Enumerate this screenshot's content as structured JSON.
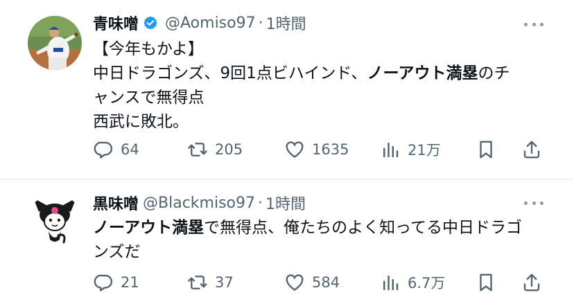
{
  "tweets": [
    {
      "display_name": "青味噌",
      "handle": "@Aomiso97",
      "separator": "·",
      "time": "1時間",
      "text_lines": [
        [
          {
            "t": "【今年もかよ】",
            "b": false
          }
        ],
        [
          {
            "t": "中日ドラゴンズ、9回1点ビハインド、",
            "b": false
          },
          {
            "t": "ノーアウト満塁",
            "b": true
          },
          {
            "t": "のチ",
            "b": false
          }
        ],
        [
          {
            "t": "ャンスで無得点",
            "b": false
          }
        ],
        [
          {
            "t": "西武に敗北。",
            "b": false
          }
        ]
      ],
      "replies": "64",
      "retweets": "205",
      "likes": "1635",
      "views": "21万",
      "verified": true
    },
    {
      "display_name": "黒味噌",
      "handle": "@Blackmiso97",
      "separator": "·",
      "time": "1時間",
      "text_lines": [
        [
          {
            "t": "ノーアウト満塁",
            "b": true
          },
          {
            "t": "で無得点、俺たちのよく知ってる中日ドラゴ",
            "b": false
          }
        ],
        [
          {
            "t": "ンズだ",
            "b": false
          }
        ]
      ],
      "replies": "21",
      "retweets": "37",
      "likes": "584",
      "views": "6.7万",
      "verified": false
    }
  ],
  "icons": {
    "verified": "verified-badge-icon",
    "more": "more-dots-icon",
    "reply": "reply-icon",
    "retweet": "retweet-icon",
    "like": "heart-icon",
    "views": "views-icon",
    "bookmark": "bookmark-icon",
    "share": "share-icon"
  },
  "colors": {
    "text": "#0f1419",
    "secondary": "#536471",
    "verified": "#1d9bf0",
    "divider": "#eff3f4"
  }
}
